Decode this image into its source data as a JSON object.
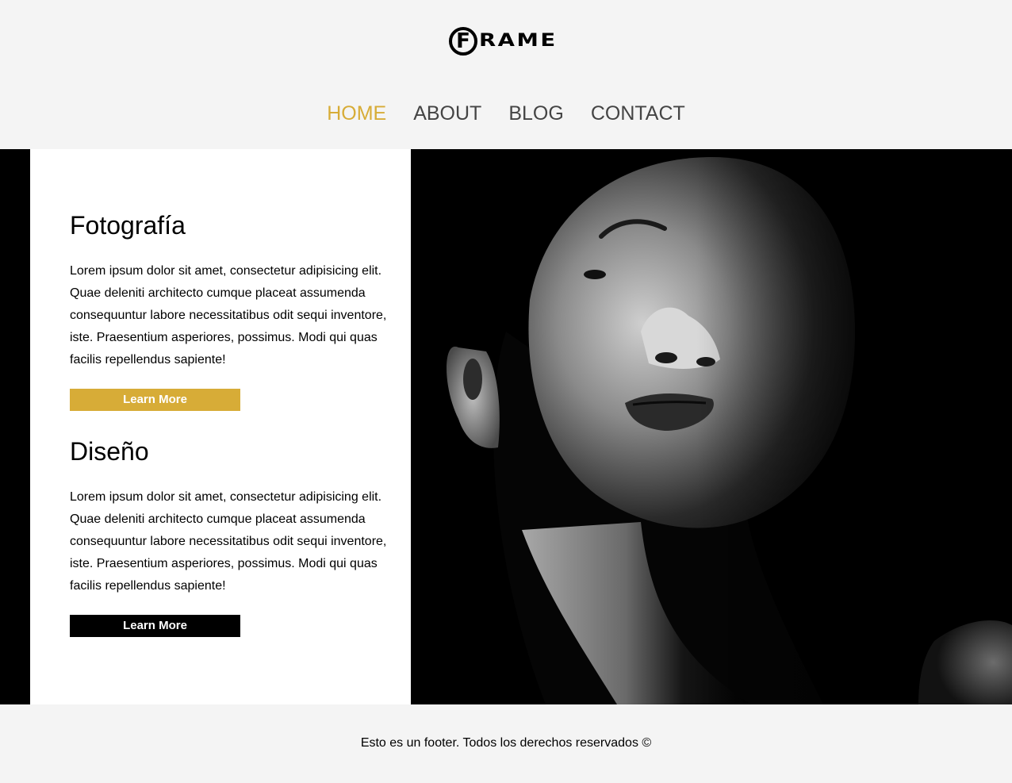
{
  "header": {
    "logo": {
      "initial": "F",
      "text": "RAME"
    },
    "nav": [
      {
        "label": "HOME",
        "active": true
      },
      {
        "label": "ABOUT",
        "active": false
      },
      {
        "label": "BLOG",
        "active": false
      },
      {
        "label": "CONTACT",
        "active": false
      }
    ]
  },
  "sections": [
    {
      "title": "Fotografía",
      "body": "Lorem ipsum dolor sit amet, consectetur adipisicing elit. Quae deleniti architecto cumque placeat assumenda consequuntur labore necessitatibus odit sequi inventore, iste. Praesentium asperiores, possimus. Modi qui quas facilis repellendus sapiente!",
      "button_label": "Learn More",
      "button_color": "#d7ac37"
    },
    {
      "title": "Diseño",
      "body": "Lorem ipsum dolor sit amet, consectetur adipisicing elit. Quae deleniti architecto cumque placeat assumenda consequuntur labore necessitatibus odit sequi inventore, iste. Praesentium asperiores, possimus. Modi qui quas facilis repellendus sapiente!",
      "button_label": "Learn More",
      "button_color": "#000000"
    }
  ],
  "footer": {
    "text": "Esto es un footer. Todos los derechos reservados ©"
  },
  "colors": {
    "accent": "#d7ac37",
    "page_background": "#f4f4f4",
    "nav_text": "#444444"
  }
}
